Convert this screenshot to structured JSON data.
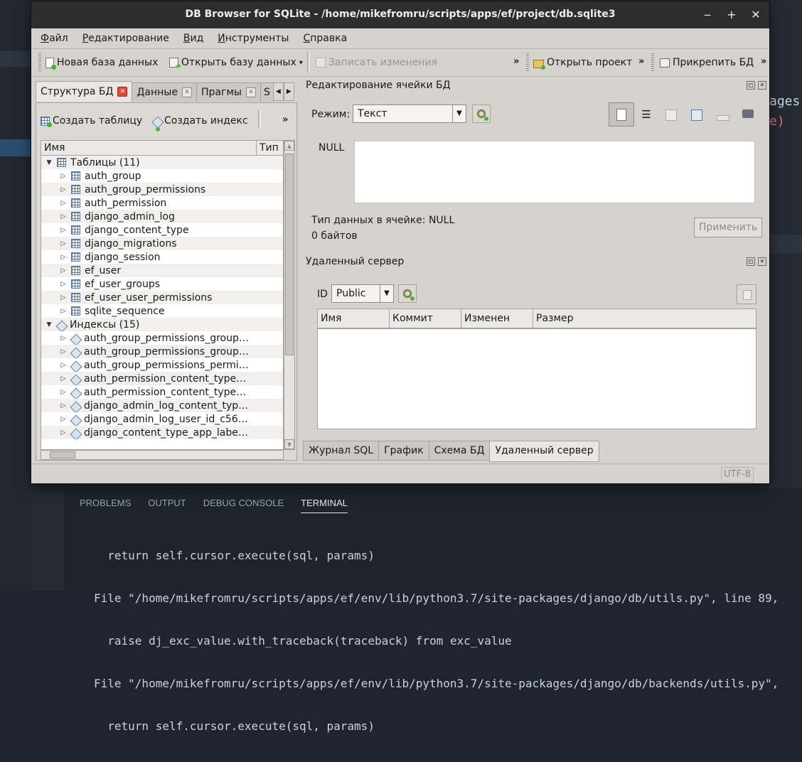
{
  "bg_editor": {
    "code_line_1": "ages",
    "code_line_2": "e)",
    "panel_tabs": [
      "PROBLEMS",
      "OUTPUT",
      "DEBUG CONSOLE",
      "TERMINAL"
    ],
    "terminal_lines": [
      "  return self.cursor.execute(sql, params)",
      "File \"/home/mikefromru/scripts/apps/ef/env/lib/python3.7/site-packages/django/db/utils.py\", line 89,",
      "  raise dj_exc_value.with_traceback(traceback) from exc_value",
      "File \"/home/mikefromru/scripts/apps/ef/env/lib/python3.7/site-packages/django/db/backends/utils.py\",",
      "  return self.cursor.execute(sql, params)"
    ]
  },
  "window": {
    "title": "DB Browser for SQLite - /home/mikefromru/scripts/apps/ef/project/db.sqlite3",
    "buttons": {
      "minimize": "‒",
      "maximize": "+",
      "close": "✕"
    }
  },
  "menu": [
    {
      "mnemonic": "Ф",
      "rest": "айл"
    },
    {
      "mnemonic": "Р",
      "rest": "едактирование"
    },
    {
      "mnemonic": "В",
      "rest": "ид"
    },
    {
      "mnemonic": "И",
      "rest": "нструменты"
    },
    {
      "mnemonic": "С",
      "rest": "правка"
    }
  ],
  "toolbar": {
    "new_db": "Новая база данных",
    "open_db": "Открыть базу данных",
    "write_changes": "Записать изменения",
    "open_project": "Открыть проект",
    "attach_db": "Прикрепить БД",
    "overflow": "»",
    "dropdown": "▾"
  },
  "left_tabs": {
    "structure": "Структура БД",
    "data": "Данные",
    "pragmas": "Прагмы",
    "sql": "S"
  },
  "left_toolbar": {
    "create_table": "Создать таблицу",
    "create_index": "Создать индекс",
    "overflow": "»"
  },
  "tree": {
    "col_name": "Имя",
    "col_type": "Тип",
    "tables_header": "Таблицы (11)",
    "tables": [
      "auth_group",
      "auth_group_permissions",
      "auth_permission",
      "django_admin_log",
      "django_content_type",
      "django_migrations",
      "django_session",
      "ef_user",
      "ef_user_groups",
      "ef_user_user_permissions",
      "sqlite_sequence"
    ],
    "indexes_header": "Индексы (15)",
    "indexes": [
      "auth_group_permissions_group…",
      "auth_group_permissions_group…",
      "auth_group_permissions_permi…",
      "auth_permission_content_type…",
      "auth_permission_content_type…",
      "django_admin_log_content_typ…",
      "django_admin_log_user_id_c56…",
      "django_content_type_app_labe…"
    ]
  },
  "cell_editor": {
    "title": "Редактирование ячейки БД",
    "mode_label": "Режим:",
    "mode_value": "Текст",
    "null_label": "NULL",
    "type_info": "Тип данных в ячейке: NULL",
    "size_info": "0 байтов",
    "apply_button": "Применить"
  },
  "remote": {
    "title": "Удаленный сервер",
    "id_label": "ID",
    "id_value": "Public",
    "columns": [
      "Имя",
      "Коммит",
      "Изменен",
      "Размер"
    ]
  },
  "bottom_tabs": [
    "Журнал SQL",
    "График",
    "Схема БД",
    "Удаленный сервер"
  ],
  "status": {
    "encoding": "UTF-8"
  }
}
